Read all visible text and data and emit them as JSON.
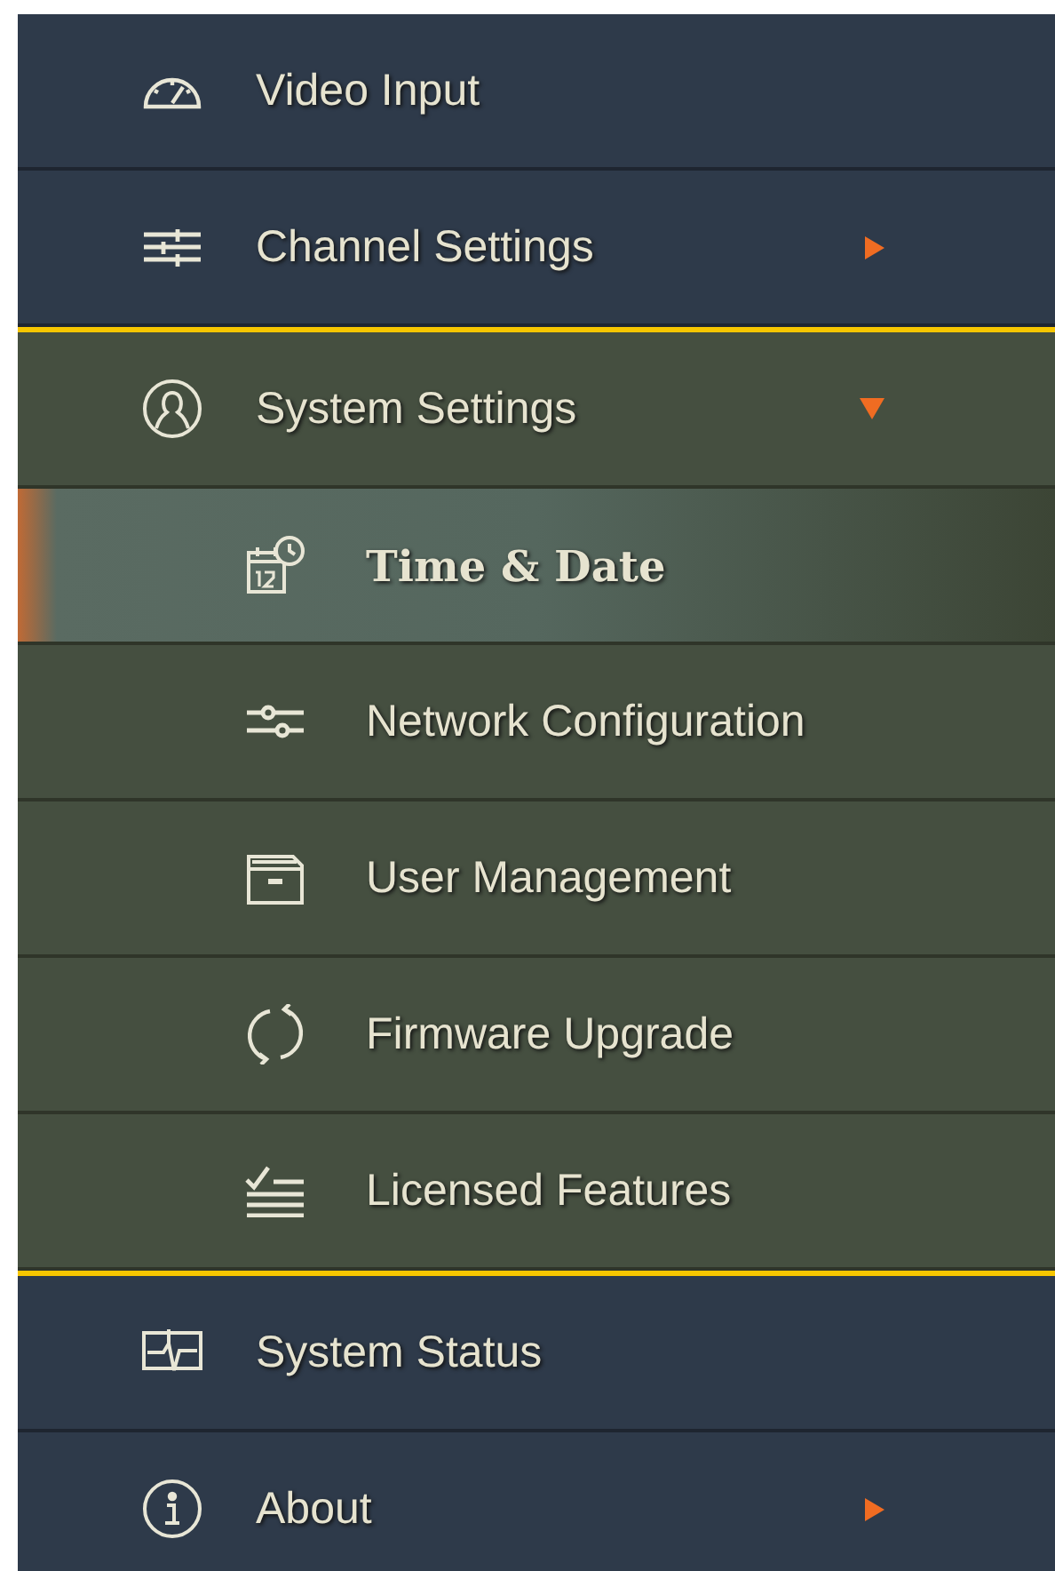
{
  "menu": [
    {
      "label": "Video Input",
      "has_submenu": false,
      "expanded": false,
      "outlined": false
    },
    {
      "label": "Channel Settings",
      "has_submenu": true,
      "expanded": false,
      "outlined": false
    },
    {
      "label": "System Settings",
      "has_submenu": true,
      "expanded": true,
      "outlined": true,
      "children": [
        {
          "label": "Time & Date",
          "selected": true
        },
        {
          "label": "Network Configuration",
          "selected": false
        },
        {
          "label": "User Management",
          "selected": false
        },
        {
          "label": "Firmware Upgrade",
          "selected": false
        },
        {
          "label": "Licensed Features",
          "selected": false
        }
      ]
    },
    {
      "label": "System Status",
      "has_submenu": false,
      "expanded": false,
      "outlined": false
    },
    {
      "label": "About",
      "has_submenu": true,
      "expanded": false,
      "outlined": false
    }
  ]
}
